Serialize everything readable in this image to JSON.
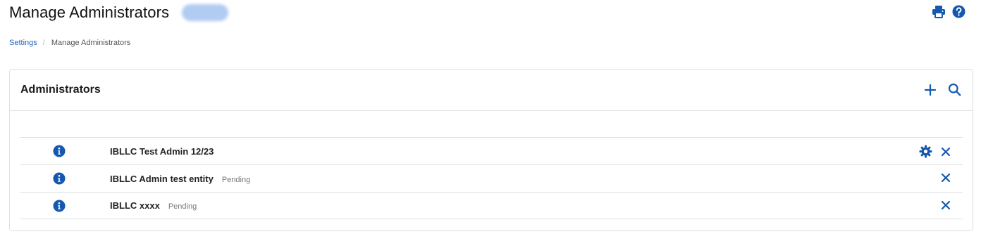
{
  "page": {
    "title": "Manage Administrators"
  },
  "breadcrumb": {
    "parent": "Settings",
    "separator": "/",
    "current": "Manage Administrators"
  },
  "card": {
    "title": "Administrators"
  },
  "administrators": [
    {
      "name": "IBLLC Test Admin 12/23",
      "status": "",
      "has_settings": true
    },
    {
      "name": "IBLLC Admin test entity",
      "status": "Pending",
      "has_settings": false
    },
    {
      "name": "IBLLC xxxx",
      "status": "Pending",
      "has_settings": false
    }
  ],
  "icons": {
    "print": "print-icon",
    "help": "help-icon",
    "add": "plus-icon",
    "search": "search-icon",
    "info": "info-icon",
    "settings": "gear-icon",
    "remove": "close-icon"
  },
  "colors": {
    "accent": "#1558b0",
    "link": "#2563b8",
    "border": "#dcdfe3"
  }
}
